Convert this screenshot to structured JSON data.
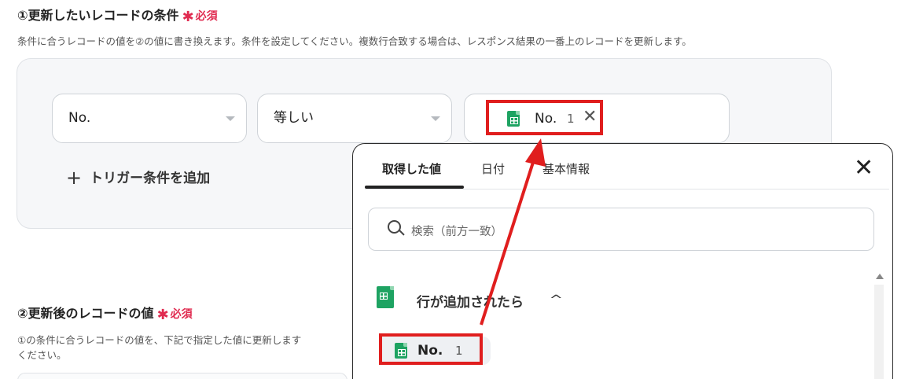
{
  "section1": {
    "title": "①更新したいレコードの条件",
    "required": "必須",
    "description": "条件に合うレコードの値を②の値に書き換えます。条件を設定してください。複数行合致する場合は、レスポンス結果の一番上のレコードを更新します。",
    "field_select": "No.",
    "operator_select": "等しい",
    "value_chip": {
      "label": "No.",
      "number": "1",
      "icon": "sheets-icon"
    },
    "add_trigger": "トリガー条件を追加"
  },
  "section2": {
    "title": "②更新後のレコードの値",
    "required": "必須",
    "description_line1": "①の条件に合うレコードの値を、下記で指定した値に更新します",
    "description_line2": "ください。"
  },
  "dropdown": {
    "tabs": [
      "取得した値",
      "日付",
      "基本情報"
    ],
    "active_tab": "取得した値",
    "search_placeholder": "検索（前方一致）",
    "group": {
      "label": "行が追加されたら",
      "icon": "sheets-icon",
      "expanded": true
    },
    "items": [
      {
        "label": "No.",
        "value": "1"
      }
    ]
  },
  "colors": {
    "required": "#e02b50",
    "highlight": "#e01e1e",
    "sheets": "#1ea362"
  }
}
